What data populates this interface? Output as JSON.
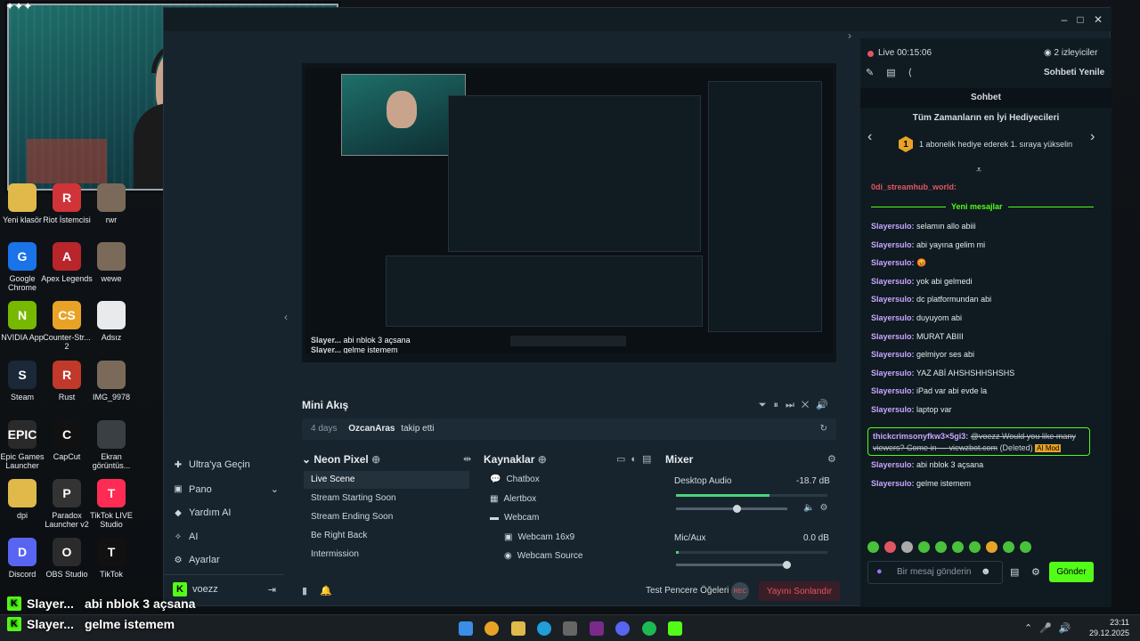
{
  "desktop": {
    "icons": [
      {
        "label": "Yeni klasör",
        "color": "#e0b94a",
        "glyph": ""
      },
      {
        "label": "Riot İstemcisi",
        "color": "#d13438",
        "glyph": "R"
      },
      {
        "label": "rwr",
        "color": "#7b6a5a",
        "glyph": ""
      },
      {
        "label": "Google Chrome",
        "color": "#1a73e8",
        "glyph": "G"
      },
      {
        "label": "Apex Legends",
        "color": "#b8262b",
        "glyph": "A"
      },
      {
        "label": "wewe",
        "color": "#7b6a5a",
        "glyph": ""
      },
      {
        "label": "NVIDIA App",
        "color": "#76b900",
        "glyph": "N"
      },
      {
        "label": "Counter-Str... 2",
        "color": "#e8a326",
        "glyph": "CS"
      },
      {
        "label": "Adsız",
        "color": "#e8eaec",
        "glyph": ""
      },
      {
        "label": "Steam",
        "color": "#1b2838",
        "glyph": "S"
      },
      {
        "label": "Rust",
        "color": "#c0392b",
        "glyph": "R"
      },
      {
        "label": "IMG_9978",
        "color": "#7b6a5a",
        "glyph": ""
      },
      {
        "label": "Epic Games Launcher",
        "color": "#2a2a2a",
        "glyph": "EPIC"
      },
      {
        "label": "CapCut",
        "color": "#111",
        "glyph": "C"
      },
      {
        "label": "Ekran görüntüs...",
        "color": "#3a3f44",
        "glyph": ""
      },
      {
        "label": "dpi",
        "color": "#e0b94a",
        "glyph": ""
      },
      {
        "label": "Paradox Launcher v2",
        "color": "#333",
        "glyph": "P"
      },
      {
        "label": "TikTok LIVE Studio",
        "color": "#fe2c55",
        "glyph": "T"
      },
      {
        "label": "Discord",
        "color": "#5865f2",
        "glyph": "D"
      },
      {
        "label": "OBS Studio",
        "color": "#2b2b2b",
        "glyph": "O"
      },
      {
        "label": "TikTok",
        "color": "#111",
        "glyph": "T"
      }
    ]
  },
  "app": {
    "window_controls": {
      "minimize": "–",
      "maximize": "□",
      "close": "✕"
    },
    "left_nav": [
      {
        "label": "Ultra'ya Geçin",
        "icon": "ultra-icon"
      },
      {
        "label": "Pano",
        "icon": "dashboard-icon"
      },
      {
        "label": "Yardım AI",
        "icon": "help-icon"
      },
      {
        "label": "AI",
        "icon": "ai-icon"
      },
      {
        "label": "Ayarlar",
        "icon": "gear-icon"
      }
    ],
    "user": {
      "name": "voezz"
    },
    "preview": {
      "chat_overlay": [
        {
          "user": "Slayer...",
          "msg": "abi nblok 3 açsana"
        },
        {
          "user": "Slayer...",
          "msg": "gelme istemem"
        }
      ]
    },
    "mini_feed": {
      "title": "Mini Akış",
      "event": {
        "time": "4 days",
        "user": "OzcanAras",
        "action": "takip etti"
      }
    },
    "scenes": {
      "title": "Neon Pixel",
      "items": [
        "Live Scene",
        "Stream Starting Soon",
        "Stream Ending Soon",
        "Be Right Back",
        "Intermission"
      ],
      "selected": 0
    },
    "sources": {
      "title": "Kaynaklar",
      "items": [
        {
          "label": "Chatbox",
          "indent": 0
        },
        {
          "label": "Alertbox",
          "indent": 0
        },
        {
          "label": "Webcam",
          "indent": 0
        },
        {
          "label": "Webcam 16x9",
          "indent": 1
        },
        {
          "label": "Webcam Source",
          "indent": 1
        }
      ]
    },
    "mixer": {
      "title": "Mixer",
      "channels": [
        {
          "name": "Desktop Audio",
          "db": "-18.7 dB",
          "level": 0.62,
          "fader": 0.55
        },
        {
          "name": "Mic/Aux",
          "db": "0.0 dB",
          "level": 0.02,
          "fader": 1.0
        }
      ]
    },
    "footer": {
      "test_label": "Test Pencere Öğeleri",
      "rec": "REC",
      "end_stream": "Yayını Sonlandır"
    }
  },
  "chat": {
    "live_label": "Live 00:15:06",
    "viewers": "2 izleyiciler",
    "refresh": "Sohbeti Yenile",
    "header": "Sohbet",
    "top_gifters_title": "Tüm Zamanların en İyi Hediyecileri",
    "gifter_rank": "1",
    "gifter_text": "1 abonelik hediye ederek 1. sıraya yükselin",
    "system_user": "0di_streamhub_world:",
    "new_messages": "Yeni mesajlar",
    "messages": [
      {
        "user": "Slayersulo:",
        "text": "selamın allo abiii"
      },
      {
        "user": "Slayersulo:",
        "text": "abi yayına gelim mi"
      },
      {
        "user": "Slayersulo:",
        "text": "😡"
      },
      {
        "user": "Slayersulo:",
        "text": "yok abi gelmedi"
      },
      {
        "user": "Slayersulo:",
        "text": "dc platformundan abi"
      },
      {
        "user": "Slayersulo:",
        "text": "duyuyom abi"
      },
      {
        "user": "Slayersulo:",
        "text": "MURAT ABIII"
      },
      {
        "user": "Slayersulo:",
        "text": "gelmiyor ses abi"
      },
      {
        "user": "Slayersulo:",
        "text": "YAZ ABİ AHSHSHHSHSHS"
      },
      {
        "user": "Slayersulo:",
        "text": "iPad var abi evde la"
      },
      {
        "user": "Slayersulo:",
        "text": "laptop var"
      }
    ],
    "deleted_msg": {
      "user": "thickcrimsonyfkw3×5gi3:",
      "text": "@voezz Would you like many viewers? Come in — viewzbot.com",
      "deleted": "(Deleted)",
      "badge": "AI Mod"
    },
    "messages_after": [
      {
        "user": "Slayersulo:",
        "text": "abi nblok 3 açsana"
      },
      {
        "user": "Slayersulo:",
        "text": "gelme istemem"
      }
    ],
    "input_placeholder": "Bir mesaj gönderin",
    "send": "Gönder"
  },
  "overlay": [
    {
      "user": "Slayer...",
      "msg": "abi nblok 3 açsana"
    },
    {
      "user": "Slayer...",
      "msg": "gelme istemem"
    }
  ],
  "taskbar": {
    "time": "23:11",
    "date": "29.12.2025"
  },
  "colors": {
    "accent": "#53fc18",
    "chat_user": "#c9a6ff",
    "end_stream": "#e25563"
  }
}
